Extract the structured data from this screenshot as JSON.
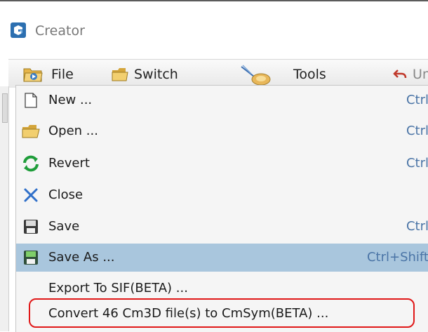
{
  "app": {
    "title": "Creator"
  },
  "menubar": {
    "file_label": "File",
    "switch_label": "Switch",
    "tools_label": "Tools",
    "undo_label": "Un"
  },
  "file_menu": {
    "items": [
      {
        "label": "New ...",
        "shortcut": "Ctrl",
        "icon": "new-document-icon"
      },
      {
        "label": "Open ...",
        "shortcut": "Ctrl",
        "icon": "open-folder-icon"
      },
      {
        "label": "Revert",
        "shortcut": "Ctrl",
        "icon": "revert-icon"
      },
      {
        "label": "Close",
        "shortcut": "",
        "icon": "close-icon"
      },
      {
        "label": "Save",
        "shortcut": "Ctrl",
        "icon": "save-icon"
      },
      {
        "label": "Save As ...",
        "shortcut": "Ctrl+Shift",
        "icon": "save-as-icon",
        "highlighted": true
      },
      {
        "label": "Export To SIF(BETA) ...",
        "shortcut": ""
      },
      {
        "label": "Convert 46 Cm3D file(s) to CmSym(BETA) ...",
        "shortcut": ""
      }
    ]
  },
  "colors": {
    "highlight": "#a9c6dd",
    "shortcut_text": "#4a74a6",
    "annotation_ring": "#e01818",
    "logo_blue": "#2c6fb0"
  }
}
